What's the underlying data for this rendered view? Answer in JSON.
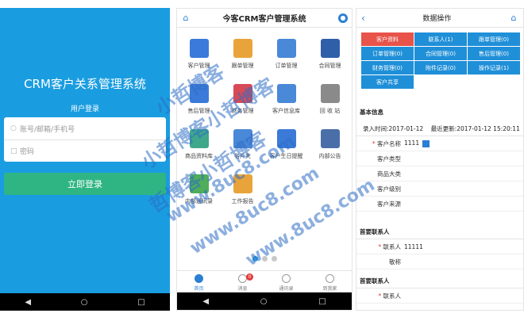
{
  "login": {
    "app_title": "CRM客户关系管理系统",
    "section_title": "用户登录",
    "username_placeholder": "账号/邮箱/手机号",
    "password_placeholder": "密码",
    "login_button": "立即登录"
  },
  "dashboard": {
    "title": "今客CRM客户管理系统",
    "grid": [
      {
        "label": "客户管理",
        "color": "#3b7ad8"
      },
      {
        "label": "跟单管理",
        "color": "#e8a43a"
      },
      {
        "label": "订单管理",
        "color": "#4a88d8"
      },
      {
        "label": "合同管理",
        "color": "#2f5fa8"
      },
      {
        "label": "售后管理",
        "color": "#3b7ad8"
      },
      {
        "label": "财务管理",
        "color": "#d84a56"
      },
      {
        "label": "客户信息库",
        "color": "#4a88d8"
      },
      {
        "label": "回 收 站",
        "color": "#8a8a8a"
      },
      {
        "label": "商品资料库",
        "color": "#3fa88a"
      },
      {
        "label": "名片夹",
        "color": "#4a88d8"
      },
      {
        "label": "客户生日提醒",
        "color": "#3b7ad8"
      },
      {
        "label": "内部公告",
        "color": "#4a6fa8"
      },
      {
        "label": "内部通讯录",
        "color": "#4fae5a"
      },
      {
        "label": "工作报告",
        "color": "#e8a43a"
      }
    ],
    "tabs": [
      {
        "label": "首页",
        "active": true
      },
      {
        "label": "消息",
        "badge": "0"
      },
      {
        "label": "通讯录"
      },
      {
        "label": "到我家"
      }
    ]
  },
  "detail": {
    "title": "数据操作",
    "buttons": [
      "客户资料",
      "联系人(1)",
      "跟单管理(0)",
      "订单管理(0)",
      "合同管理(0)",
      "售后管理(0)",
      "财务管理(0)",
      "附件记录(0)",
      "操作记录(1)",
      "客户共享"
    ],
    "basic_title": "基本信息",
    "entry_time": "录入时间:2017-01-12",
    "update_time": "最近更新:2017-01-12 15:20:11",
    "fields": [
      {
        "label": "客户名称",
        "value": "1111",
        "required": true
      },
      {
        "label": "客户类型",
        "value": ""
      },
      {
        "label": "商品大类",
        "value": ""
      },
      {
        "label": "客户级别",
        "value": ""
      },
      {
        "label": "客户来源",
        "value": ""
      }
    ],
    "contact_title": "首要联系人",
    "contact_fields": [
      {
        "label": "联系人",
        "value": "11111",
        "required": true
      },
      {
        "label": "敬称",
        "value": ""
      }
    ],
    "contact_title2": "首要联系人",
    "contact_fields2": [
      {
        "label": "联系人",
        "value": "",
        "required": true
      }
    ]
  },
  "watermark": {
    "line1": "小哲博客",
    "line2": "小哲博客小哲博客",
    "line3": "哲博客小哲博客",
    "url1": "www.8uc8.com",
    "url2": "www.8uc8.com",
    "url3": "www.8uc8.com"
  }
}
